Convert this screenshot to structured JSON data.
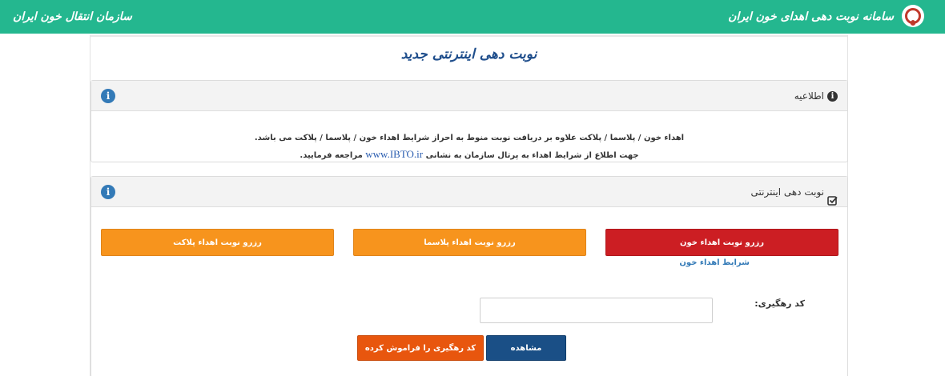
{
  "header": {
    "site_title": "سامانه نوبت دهی اهدای خون ایران",
    "org_name": "سازمان انتقال خون ایران"
  },
  "page_title": "نوبت دهی اینترنتی جدید",
  "notice_panel": {
    "title": "اطلاعیه",
    "line1": "اهداء خون / پلاسما / پلاکت علاوه بر دریافت نوبت منوط به احراز شرایط اهداء خون / پلاسما / پلاکت می باشد.",
    "line2_before": "جهت اطلاع از شرایط اهداء به پرتال سازمان به نشانی",
    "line2_url": "www.IBTO.ir",
    "line2_after": "مراجعه فرمایید."
  },
  "booking_panel": {
    "title": "نوبت دهی اینترنتی",
    "btn_blood": "رزرو نوبت اهداء خون",
    "btn_plasma": "رزرو نوبت اهداء پلاسما",
    "btn_platelet": "رزرو نوبت اهداء پلاکت",
    "link_conditions": "شرایط اهداء خون",
    "tracking_label": "کد رهگیری:",
    "tracking_placeholder": "",
    "btn_view": "مشاهده",
    "btn_forgot": "کد رهگیری را فراموش کرده ام!"
  },
  "colors": {
    "header_bg": "#24b78f",
    "blood_button": "#cc1e23",
    "orange_button": "#f7941d",
    "view_button": "#1a4f86",
    "forgot_button": "#e8560e",
    "info_icon": "#337ab7"
  }
}
